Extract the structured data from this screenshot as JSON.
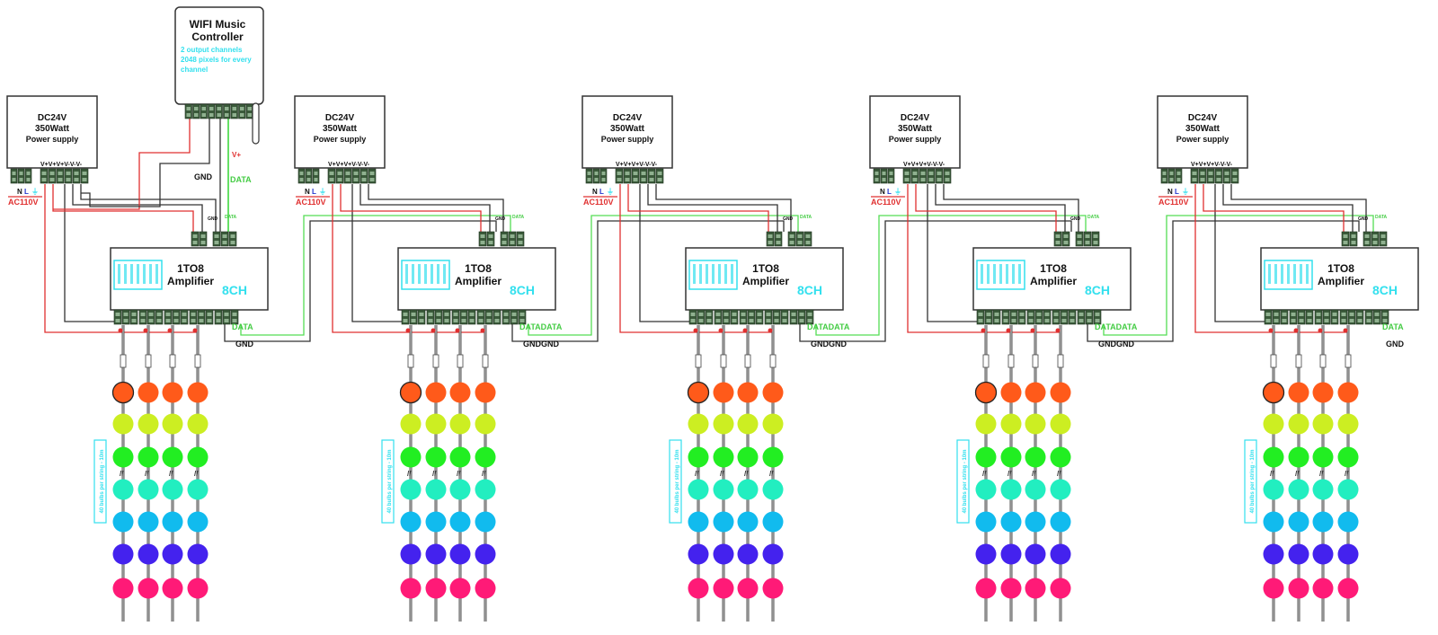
{
  "controller": {
    "title_line1": "WIFI Music",
    "title_line2": "Controller",
    "info_line1": "2 output channels",
    "info_line2": "2048 pixels for every",
    "info_line3": "channel",
    "wire_labels": {
      "vplus": "V+",
      "gnd": "GND",
      "data": "DATA"
    }
  },
  "power_supply": {
    "line1": "DC24V",
    "line2": "350Watt",
    "line3": "Power supply",
    "terminal_labels": "V+V+V+V-V-V-",
    "input_n": "N",
    "input_l": "L",
    "input_voltage": "AC110V"
  },
  "amplifier": {
    "line1": "1TO8",
    "line2": "Amplifier",
    "channels": "8CH",
    "top_gnd": "GND",
    "top_data": "DATA"
  },
  "string_label": "40 bulbs per string - 10m",
  "units": [
    {
      "data_label": "DATA",
      "gnd_label": "GND"
    },
    {
      "data_label": "DATADATA",
      "gnd_label": "GNDGND"
    },
    {
      "data_label": "DATADATA",
      "gnd_label": "GNDGND"
    },
    {
      "data_label": "DATADATA",
      "gnd_label": "GNDGND"
    },
    {
      "data_label": "DATA",
      "gnd_label": "GND"
    }
  ],
  "colors": {
    "power_wire": "#e03030",
    "gnd_wire": "#333333",
    "data_wire": "#55dd55",
    "accent_cyan": "#33e0ee",
    "terminal": "#3a5a3a",
    "bulbs": [
      "#ff5a1a",
      "#ccee22",
      "#22ee22",
      "#22eec0",
      "#11bbee",
      "#4422ee",
      "#ff1a77"
    ]
  }
}
